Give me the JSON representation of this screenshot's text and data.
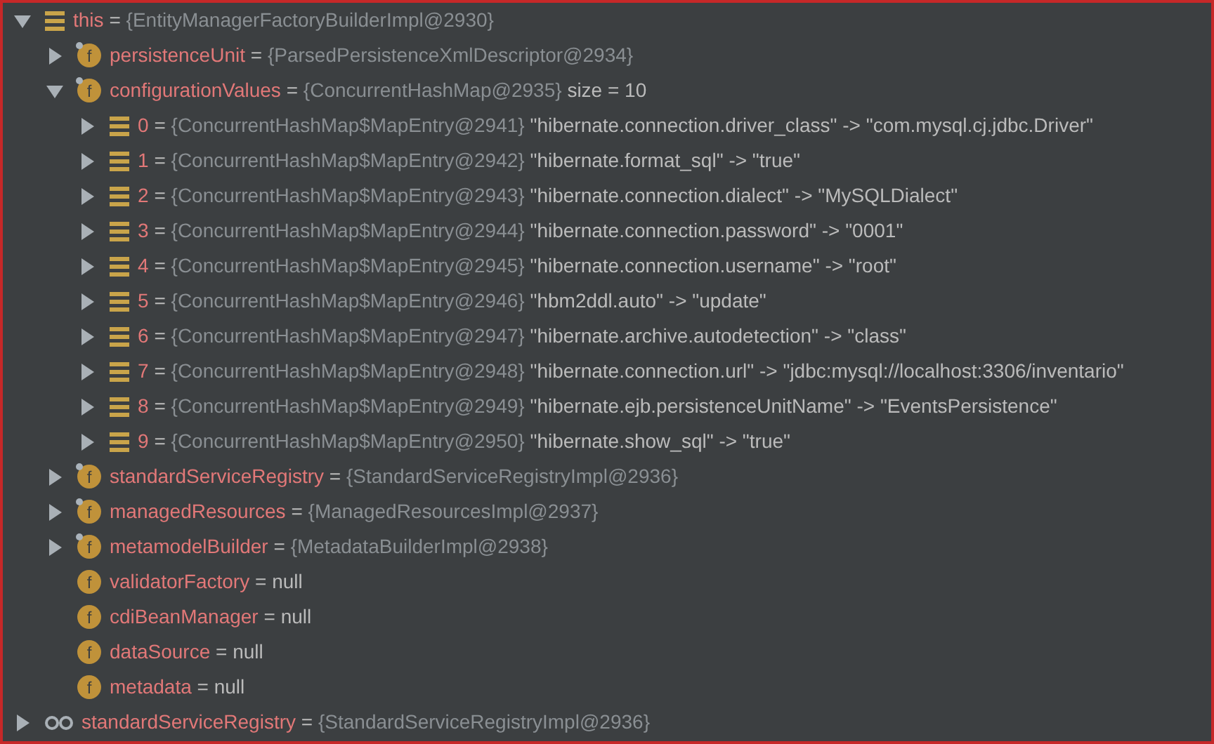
{
  "tree": [
    {
      "kind": "object",
      "name": "this",
      "assign": "=",
      "ref": "{EntityManagerFactoryBuilderImpl@2930}",
      "expanded": true,
      "children": [
        {
          "kind": "field",
          "badge": "f",
          "final": true,
          "name": "persistenceUnit",
          "assign": "=",
          "ref": "{ParsedPersistenceXmlDescriptor@2934}",
          "expanded": false
        },
        {
          "kind": "field",
          "badge": "f",
          "final": true,
          "name": "configurationValues",
          "assign": "=",
          "ref": "{ConcurrentHashMap@2935}",
          "value": "size = 10",
          "expanded": true,
          "children": [
            {
              "kind": "object",
              "name": "0",
              "assign": "=",
              "ref": "{ConcurrentHashMap$MapEntry@2941}",
              "value": "\"hibernate.connection.driver_class\" -> \"com.mysql.cj.jdbc.Driver\"",
              "expanded": false
            },
            {
              "kind": "object",
              "name": "1",
              "assign": "=",
              "ref": "{ConcurrentHashMap$MapEntry@2942}",
              "value": "\"hibernate.format_sql\" -> \"true\"",
              "expanded": false
            },
            {
              "kind": "object",
              "name": "2",
              "assign": "=",
              "ref": "{ConcurrentHashMap$MapEntry@2943}",
              "value": "\"hibernate.connection.dialect\" -> \"MySQLDialect\"",
              "expanded": false
            },
            {
              "kind": "object",
              "name": "3",
              "assign": "=",
              "ref": "{ConcurrentHashMap$MapEntry@2944}",
              "value": "\"hibernate.connection.password\" -> \"0001\"",
              "expanded": false
            },
            {
              "kind": "object",
              "name": "4",
              "assign": "=",
              "ref": "{ConcurrentHashMap$MapEntry@2945}",
              "value": "\"hibernate.connection.username\" -> \"root\"",
              "expanded": false
            },
            {
              "kind": "object",
              "name": "5",
              "assign": "=",
              "ref": "{ConcurrentHashMap$MapEntry@2946}",
              "value": "\"hbm2ddl.auto\" -> \"update\"",
              "expanded": false
            },
            {
              "kind": "object",
              "name": "6",
              "assign": "=",
              "ref": "{ConcurrentHashMap$MapEntry@2947}",
              "value": "\"hibernate.archive.autodetection\" -> \"class\"",
              "expanded": false
            },
            {
              "kind": "object",
              "name": "7",
              "assign": "=",
              "ref": "{ConcurrentHashMap$MapEntry@2948}",
              "value": "\"hibernate.connection.url\" -> \"jdbc:mysql://localhost:3306/inventario\"",
              "expanded": false
            },
            {
              "kind": "object",
              "name": "8",
              "assign": "=",
              "ref": "{ConcurrentHashMap$MapEntry@2949}",
              "value": "\"hibernate.ejb.persistenceUnitName\" -> \"EventsPersistence\"",
              "expanded": false
            },
            {
              "kind": "object",
              "name": "9",
              "assign": "=",
              "ref": "{ConcurrentHashMap$MapEntry@2950}",
              "value": "\"hibernate.show_sql\" -> \"true\"",
              "expanded": false
            }
          ]
        },
        {
          "kind": "field",
          "badge": "f",
          "final": true,
          "name": "standardServiceRegistry",
          "assign": "=",
          "ref": "{StandardServiceRegistryImpl@2936}",
          "expanded": false
        },
        {
          "kind": "field",
          "badge": "f",
          "final": true,
          "name": "managedResources",
          "assign": "=",
          "ref": "{ManagedResourcesImpl@2937}",
          "expanded": false
        },
        {
          "kind": "field",
          "badge": "f",
          "final": true,
          "name": "metamodelBuilder",
          "assign": "=",
          "ref": "{MetadataBuilderImpl@2938}",
          "expanded": false
        },
        {
          "kind": "field",
          "badge": "f",
          "final": false,
          "name": "validatorFactory",
          "assign": "=",
          "value": "null"
        },
        {
          "kind": "field",
          "badge": "f",
          "final": false,
          "name": "cdiBeanManager",
          "assign": "=",
          "value": "null"
        },
        {
          "kind": "field",
          "badge": "f",
          "final": false,
          "name": "dataSource",
          "assign": "=",
          "value": "null"
        },
        {
          "kind": "field",
          "badge": "f",
          "final": false,
          "name": "metadata",
          "assign": "=",
          "value": "null"
        }
      ]
    },
    {
      "kind": "watch",
      "name": "standardServiceRegistry",
      "assign": "=",
      "ref": "{StandardServiceRegistryImpl@2936}",
      "expanded": false
    }
  ]
}
